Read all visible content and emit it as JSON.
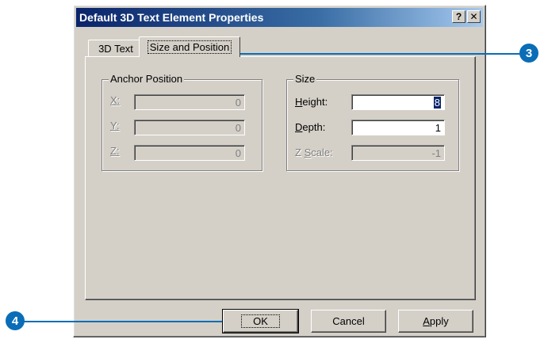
{
  "window": {
    "title": "Default 3D Text Element Properties",
    "help_label": "?",
    "close_label": "✕"
  },
  "tabs": [
    {
      "label": "3D Text"
    },
    {
      "label": "Size and Position"
    }
  ],
  "anchor_position": {
    "legend": "Anchor Position",
    "x": {
      "label": "X:",
      "value": "0"
    },
    "y": {
      "label": "Y:",
      "value": "0"
    },
    "z": {
      "label": "Z:",
      "value": "0"
    }
  },
  "size": {
    "legend": "Size",
    "height": {
      "label_pre": "",
      "label_u": "H",
      "label_post": "eight:",
      "value": "8"
    },
    "depth": {
      "label_pre": "",
      "label_u": "D",
      "label_post": "epth:",
      "value": "1"
    },
    "zscale": {
      "label_pre": "Z ",
      "label_u": "S",
      "label_post": "cale:",
      "value": "-1"
    }
  },
  "buttons": {
    "ok": "OK",
    "cancel": "Cancel",
    "apply": "Apply"
  },
  "callouts": {
    "step3": "3",
    "step4": "4"
  },
  "colors": {
    "callout": "#0a6db7",
    "titlebar": "#0a246a",
    "dialog_face": "#d4d0c8"
  }
}
